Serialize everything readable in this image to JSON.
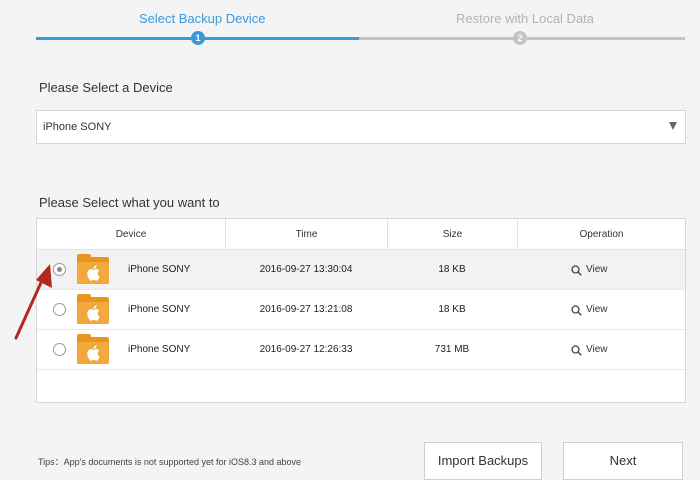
{
  "steps": [
    {
      "label": "Select Backup Device",
      "number": "1",
      "active": true
    },
    {
      "label": "Restore with Local Data",
      "number": "2",
      "active": false
    }
  ],
  "device_section": {
    "title": "Please Select a Device",
    "selected_device": "iPhone SONY"
  },
  "backup_section": {
    "title": "Please Select what you want to",
    "columns": [
      "Device",
      "Time",
      "Size",
      "Operation"
    ],
    "rows": [
      {
        "device": "iPhone SONY",
        "time": "2016-09-27 13:30:04",
        "size": "18 KB",
        "operation": "View",
        "selected": true
      },
      {
        "device": "iPhone SONY",
        "time": "2016-09-27 13:21:08",
        "size": "18 KB",
        "operation": "View",
        "selected": false
      },
      {
        "device": "iPhone SONY",
        "time": "2016-09-27 12:26:33",
        "size": "731 MB",
        "operation": "View",
        "selected": false
      }
    ]
  },
  "footer": {
    "tips": "Tips：App's documents is not supported yet for iOS8.3 and above",
    "import_label": "Import Backups",
    "next_label": "Next"
  },
  "colors": {
    "accent": "#3a9ad9",
    "inactive": "#c4c4c4",
    "folder": "#f2a93b",
    "annotation_arrow": "#b3281e"
  }
}
